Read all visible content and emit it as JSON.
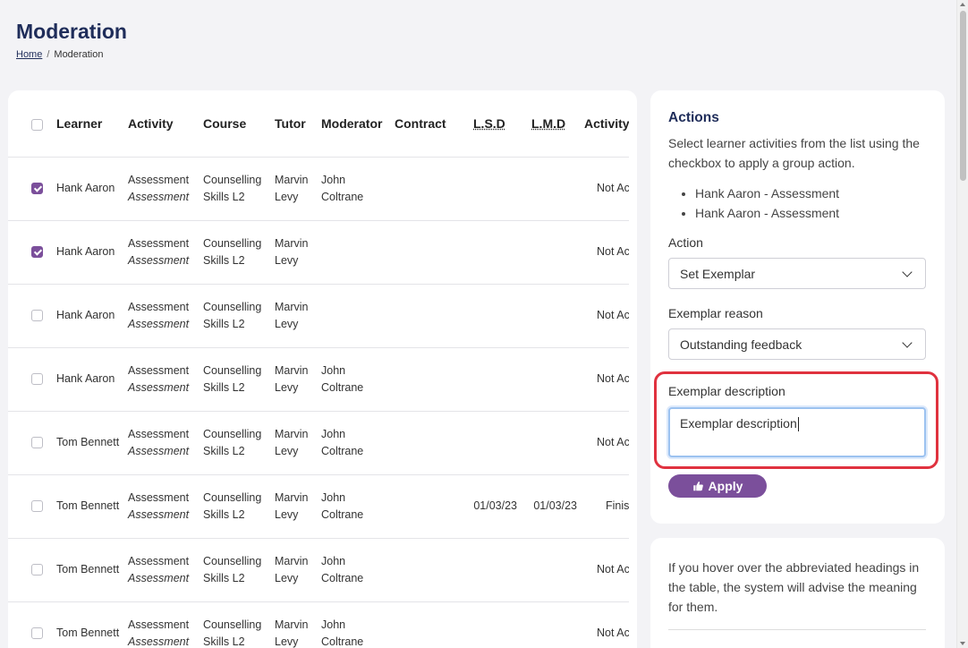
{
  "header": {
    "title": "Moderation",
    "breadcrumb_home": "Home",
    "breadcrumb_sep": "/",
    "breadcrumb_current": "Moderation"
  },
  "table": {
    "columns": [
      "Learner",
      "Activity",
      "Course",
      "Tutor",
      "Moderator",
      "Contract",
      "L.S.D",
      "L.M.D",
      "Activity"
    ],
    "rows": [
      {
        "checked": true,
        "learner": "Hank Aaron",
        "activity": "Assessment",
        "activity_type": "Assessment",
        "course": "Counselling Skills L2",
        "tutor": "Marvin Levy",
        "moderator": "John Coltrane",
        "contract": "",
        "lsd": "",
        "lmd": "",
        "status": "Not Actioned"
      },
      {
        "checked": true,
        "learner": "Hank Aaron",
        "activity": "Assessment",
        "activity_type": "Assessment",
        "course": "Counselling Skills L2",
        "tutor": "Marvin Levy",
        "moderator": "",
        "contract": "",
        "lsd": "",
        "lmd": "",
        "status": "Not Actioned"
      },
      {
        "checked": false,
        "learner": "Hank Aaron",
        "activity": "Assessment",
        "activity_type": "Assessment",
        "course": "Counselling Skills L2",
        "tutor": "Marvin Levy",
        "moderator": "",
        "contract": "",
        "lsd": "",
        "lmd": "",
        "status": "Not Actioned"
      },
      {
        "checked": false,
        "learner": "Hank Aaron",
        "activity": "Assessment",
        "activity_type": "Assessment",
        "course": "Counselling Skills L2",
        "tutor": "Marvin Levy",
        "moderator": "John Coltrane",
        "contract": "",
        "lsd": "",
        "lmd": "",
        "status": "Not Actioned"
      },
      {
        "checked": false,
        "learner": "Tom Bennett",
        "activity": "Assessment",
        "activity_type": "Assessment",
        "course": "Counselling Skills L2",
        "tutor": "Marvin Levy",
        "moderator": "John Coltrane",
        "contract": "",
        "lsd": "",
        "lmd": "",
        "status": "Not Actioned"
      },
      {
        "checked": false,
        "learner": "Tom Bennett",
        "activity": "Assessment",
        "activity_type": "Assessment",
        "course": "Counselling Skills L2",
        "tutor": "Marvin Levy",
        "moderator": "John Coltrane",
        "contract": "",
        "lsd": "01/03/23",
        "lmd": "01/03/23",
        "status": "Finished"
      },
      {
        "checked": false,
        "learner": "Tom Bennett",
        "activity": "Assessment",
        "activity_type": "Assessment",
        "course": "Counselling Skills L2",
        "tutor": "Marvin Levy",
        "moderator": "John Coltrane",
        "contract": "",
        "lsd": "",
        "lmd": "",
        "status": "Not Actioned"
      },
      {
        "checked": false,
        "learner": "Tom Bennett",
        "activity": "Assessment",
        "activity_type": "Assessment",
        "course": "Counselling Skills L2",
        "tutor": "Marvin Levy",
        "moderator": "John Coltrane",
        "contract": "",
        "lsd": "",
        "lmd": "",
        "status": "Not Actioned"
      }
    ]
  },
  "actions": {
    "title": "Actions",
    "intro": "Select learner activities from the list using the checkbox to apply a group action.",
    "selected": [
      "Hank Aaron - Assessment",
      "Hank Aaron - Assessment"
    ],
    "action_label": "Action",
    "action_value": "Set Exemplar",
    "reason_label": "Exemplar reason",
    "reason_value": "Outstanding feedback",
    "description_label": "Exemplar description",
    "description_value": "Exemplar description",
    "apply_label": "Apply",
    "accent_color": "#7b4f9b",
    "highlight_color": "#e0323f"
  },
  "info": {
    "text": "If you hover over the abbreviated headings in the table, the system will advise the meaning for them."
  }
}
